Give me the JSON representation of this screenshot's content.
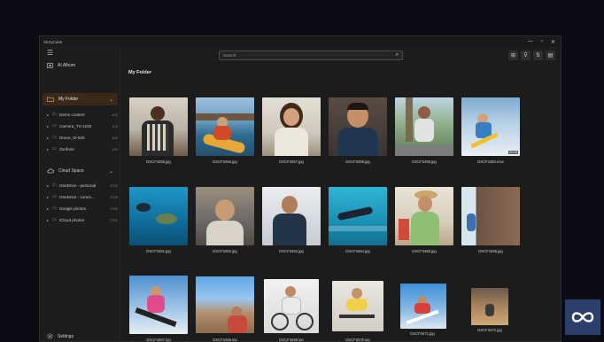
{
  "app": {
    "title": "StoryCube"
  },
  "window_controls": {
    "minimize": "—",
    "maximize": "▫",
    "close": "✕"
  },
  "sidebar": {
    "menu_icon": "☰",
    "ai_album": "AI Album",
    "my_folder": {
      "label": "My Folder",
      "chevron": "⌄"
    },
    "folders": [
      {
        "name": "Demo content",
        "count": "405"
      },
      {
        "name": "Camera_TX-1100",
        "count": "125"
      },
      {
        "name": "Drone_XI-520",
        "count": "180"
      },
      {
        "name": "Zonfone",
        "count": "460"
      }
    ],
    "cloud": {
      "label": "Cloud Space",
      "chevron": "⌄"
    },
    "cloud_items": [
      {
        "name": "OneDrive - personal",
        "count": "2765"
      },
      {
        "name": "OneDrive - comm...",
        "count": "2765"
      },
      {
        "name": "Google photos",
        "count": "2765"
      },
      {
        "name": "iCloud photos",
        "count": "2765"
      }
    ],
    "settings": "Settings",
    "arrow": "▸",
    "folder_glyph": "▭"
  },
  "toolbar": {
    "search_placeholder": "Search",
    "search_icon": "⌕",
    "tool_icons": [
      "⊞",
      "⊽",
      "⇅",
      "▤"
    ]
  },
  "main": {
    "folder_title": "My Folder",
    "photos": [
      {
        "name": "DSCF3455.jpg"
      },
      {
        "name": "DSCF3456.jpg"
      },
      {
        "name": "DSCF3457.jpg"
      },
      {
        "name": "DSCF3458.jpg"
      },
      {
        "name": "DSCF3459.jpg"
      },
      {
        "name": "DSCF3460.mov",
        "badge": "00:28"
      },
      {
        "name": "DSCF3461.jpg"
      },
      {
        "name": "DSCF3462.jpg"
      },
      {
        "name": "DSCF3463.jpg"
      },
      {
        "name": "DSCF3464.jpg"
      },
      {
        "name": "DSCF3465.jpg"
      },
      {
        "name": "DSCF3466.jpg"
      },
      {
        "name": "DSCF3467.jpg"
      },
      {
        "name": "DSCF3468.jpg"
      },
      {
        "name": "DSCF3469.jpg"
      },
      {
        "name": "DSCF3470.jpg"
      },
      {
        "name": "DSCF3471.jpg"
      },
      {
        "name": "DSCF3472.jpg"
      }
    ]
  },
  "colors": {
    "accent_selected": "#3b2a1a",
    "brand_tile": "#2b3f6a"
  }
}
